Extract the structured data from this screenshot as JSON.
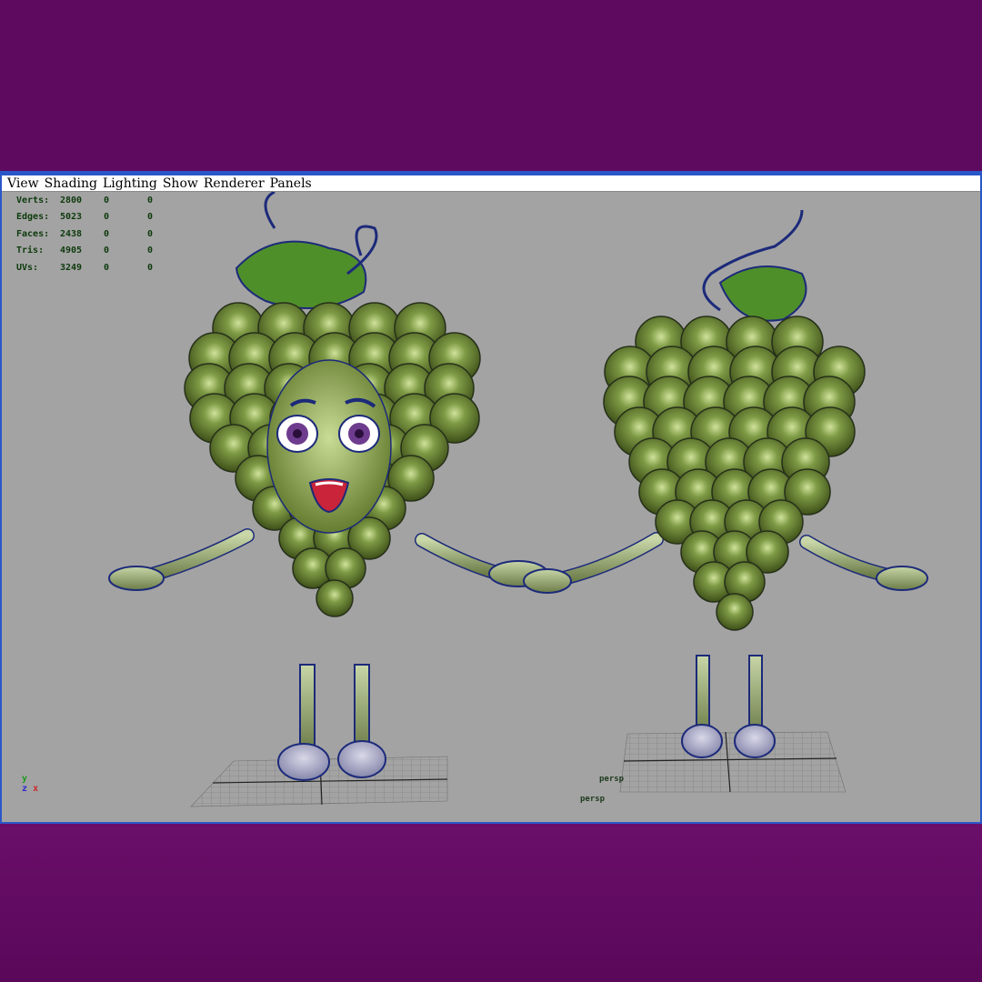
{
  "menu": {
    "items": [
      {
        "label": "View"
      },
      {
        "label": "Shading"
      },
      {
        "label": "Lighting"
      },
      {
        "label": "Show"
      },
      {
        "label": "Renderer"
      },
      {
        "label": "Panels"
      }
    ]
  },
  "hud": {
    "rows": [
      {
        "label": "Verts:",
        "v1": "2800",
        "v2": "0",
        "v3": "0"
      },
      {
        "label": "Edges:",
        "v1": "5023",
        "v2": "0",
        "v3": "0"
      },
      {
        "label": "Faces:",
        "v1": "2438",
        "v2": "0",
        "v3": "0"
      },
      {
        "label": "Tris:",
        "v1": "4905",
        "v2": "0",
        "v3": "0"
      },
      {
        "label": "UVs:",
        "v1": "3249",
        "v2": "0",
        "v3": "0"
      }
    ]
  },
  "camera": {
    "label_primary": "persp",
    "label_secondary": "persp"
  },
  "axis": {
    "y": "y",
    "z": "z",
    "x": "x"
  },
  "colors": {
    "background": "#5e0a5e",
    "frame": "#2a57c8",
    "viewport": "#a3a3a3",
    "grape": "#6b8a3a",
    "wire": "#1c2a7a"
  }
}
